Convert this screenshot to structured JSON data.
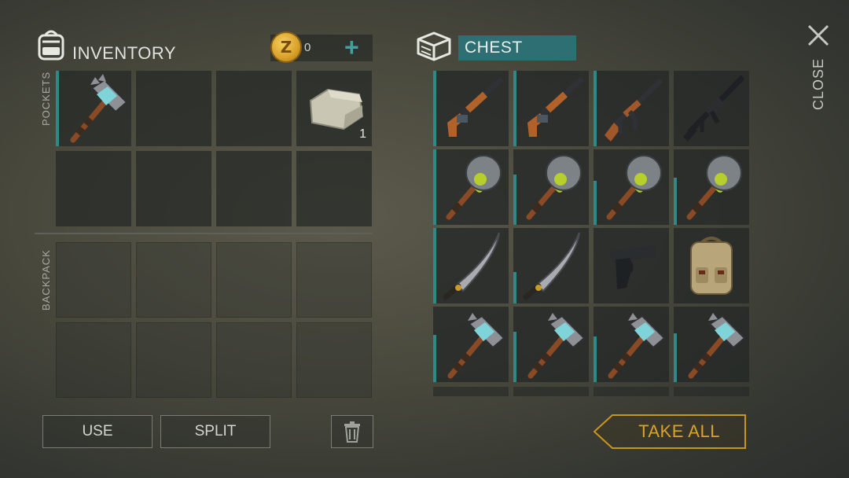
{
  "inventory": {
    "title": "INVENTORY",
    "coins": "0",
    "coin_add": "+",
    "pockets_label": "POCKETS",
    "backpack_label": "BACKPACK",
    "pockets": [
      {
        "item": "hammer-icon",
        "qty": ""
      },
      {
        "item": "",
        "qty": ""
      },
      {
        "item": "",
        "qty": ""
      },
      {
        "item": "stone-icon",
        "qty": "1"
      },
      {
        "item": "",
        "qty": ""
      },
      {
        "item": "",
        "qty": ""
      },
      {
        "item": "",
        "qty": ""
      },
      {
        "item": "",
        "qty": ""
      }
    ]
  },
  "chest": {
    "title": "CHEST",
    "items": [
      "shotgun-icon",
      "shotgun-icon",
      "ak-rifle-icon",
      "m16-rifle-icon",
      "spiked-club-icon",
      "spiked-club-icon",
      "spiked-club-icon",
      "spiked-club-icon",
      "machete-icon",
      "machete-icon",
      "pistol-icon",
      "backpack-icon",
      "hammer-icon",
      "hammer-icon",
      "hammer-icon",
      "hammer-icon"
    ]
  },
  "close_label": "CLOSE",
  "buttons": {
    "use": "USE",
    "split": "SPLIT",
    "take_all": "TAKE ALL"
  },
  "colors": {
    "accent": "#2f8a87",
    "take_all": "#d8a22b",
    "chest_title_bg": "#2d6f73"
  }
}
